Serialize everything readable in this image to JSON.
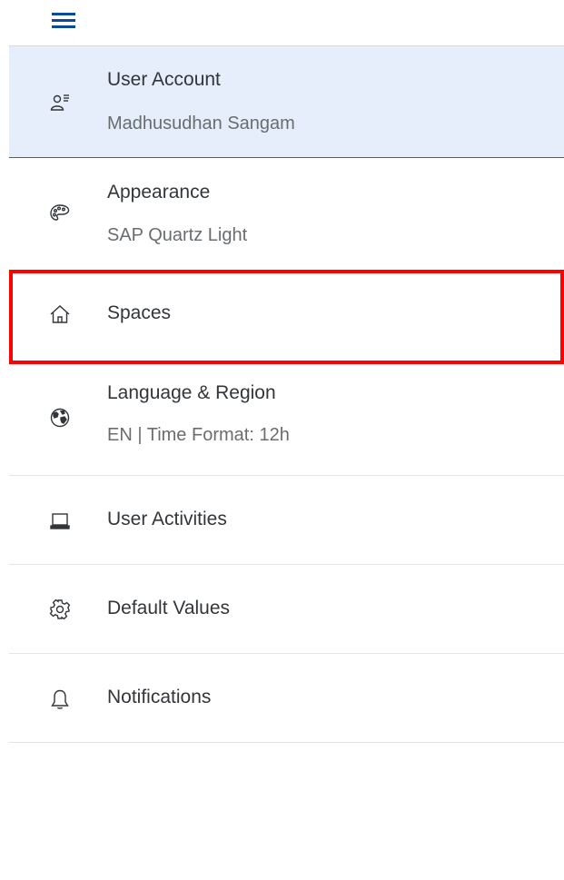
{
  "header": {
    "menu_icon": "hamburger-menu-icon"
  },
  "menu": {
    "items": [
      {
        "title": "User Account",
        "subtitle": "Madhusudhan Sangam",
        "icon": "user-settings-icon",
        "selected": true
      },
      {
        "title": "Appearance",
        "subtitle": "SAP Quartz Light",
        "icon": "palette-icon"
      },
      {
        "title": "Spaces",
        "icon": "home-icon",
        "highlighted": true
      },
      {
        "title": "Language & Region",
        "subtitle": "EN | Time Format: 12h",
        "icon": "globe-icon"
      },
      {
        "title": "User Activities",
        "icon": "laptop-icon"
      },
      {
        "title": "Default Values",
        "icon": "gear-icon"
      },
      {
        "title": "Notifications",
        "icon": "bell-icon"
      }
    ]
  },
  "colors": {
    "accent": "#0a6ed1",
    "selected_bg": "#e5eefa",
    "highlight_border": "#ff0000",
    "text": "#32363a",
    "subtext": "#6a6d70"
  }
}
